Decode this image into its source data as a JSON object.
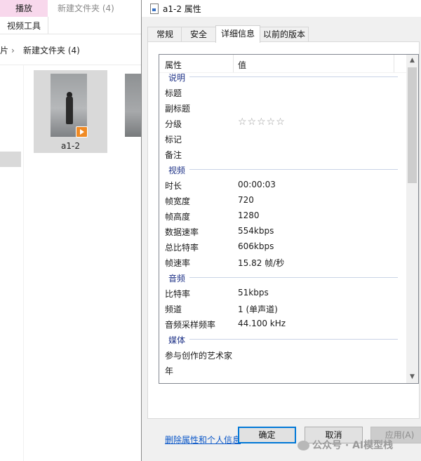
{
  "explorer": {
    "ribbon_tab": "播放",
    "ribbon_title": "新建文件夹 (4)",
    "ribbon_tool": "视频工具",
    "address_fragment": "片",
    "address_folder": "新建文件夹 (4)",
    "file_label": "a1-2"
  },
  "dialog": {
    "title": "a1-2 属性",
    "tabs": [
      "常规",
      "安全",
      "详细信息",
      "以前的版本"
    ],
    "active_tab": "详细信息",
    "col_property": "属性",
    "col_value": "值",
    "groups": {
      "description": {
        "name": "说明",
        "rows": {
          "title": {
            "name": "标题",
            "value": ""
          },
          "subtitle": {
            "name": "副标题",
            "value": ""
          },
          "rating": {
            "name": "分级",
            "value": "☆☆☆☆☆",
            "stars_filled": 0,
            "stars_total": 5
          },
          "tags": {
            "name": "标记",
            "value": ""
          },
          "comments": {
            "name": "备注",
            "value": ""
          }
        }
      },
      "video": {
        "name": "视频",
        "rows": {
          "duration": {
            "name": "时长",
            "value": "00:00:03"
          },
          "frame_width": {
            "name": "帧宽度",
            "value": "720"
          },
          "frame_height": {
            "name": "帧高度",
            "value": "1280"
          },
          "data_rate": {
            "name": "数据速率",
            "value": "554kbps"
          },
          "total_bitrate": {
            "name": "总比特率",
            "value": "606kbps"
          },
          "frame_rate": {
            "name": "帧速率",
            "value": "15.82 帧/秒"
          }
        }
      },
      "audio": {
        "name": "音频",
        "rows": {
          "bitrate": {
            "name": "比特率",
            "value": "51kbps"
          },
          "channels": {
            "name": "频道",
            "value": "1 (单声道)"
          },
          "sample_rate": {
            "name": "音频采样频率",
            "value": "44.100 kHz"
          }
        }
      },
      "media": {
        "name": "媒体",
        "rows": {
          "contributing_artists": {
            "name": "参与创作的艺术家",
            "value": ""
          },
          "year": {
            "name": "年",
            "value": ""
          }
        }
      }
    },
    "remove_link": "删除属性和个人信息",
    "buttons": {
      "ok": "确定",
      "cancel": "取消",
      "apply": "应用(A)"
    }
  },
  "watermark": "公众号 · AI模型栈",
  "colors": {
    "group_heading": "#1e3287",
    "link": "#0b57c8",
    "primary_border": "#0078d7",
    "ribbon_tab_bg": "#f8d8ec",
    "selection_bg": "#d9d9d9",
    "play_badge": "#f08a24"
  },
  "icons": [
    "play-badge-icon",
    "video-file-icon",
    "chevron-right-icon",
    "scroll-up-icon",
    "scroll-down-icon",
    "star-icon",
    "wechat-icon"
  ]
}
